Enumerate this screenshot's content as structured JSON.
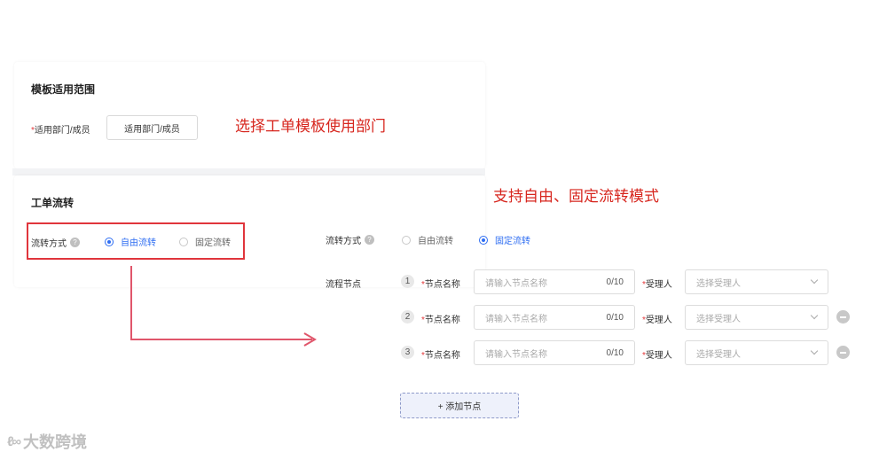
{
  "scope": {
    "title": "模板适用范围",
    "field_label": "适用部门/成员",
    "required_mark": "*",
    "button_label": "适用部门/成员"
  },
  "flow": {
    "title": "工单流转",
    "mode_label": "流转方式",
    "options": [
      "自由流转",
      "固定流转"
    ],
    "left_selected": "自由流转",
    "right_selected": "固定流转"
  },
  "annotations": {
    "scope_note": "选择工单模板使用部门",
    "flow_note": "支持自由、固定流转模式"
  },
  "nodes": {
    "section_label": "流程节点",
    "name_label": "节点名称",
    "assignee_label": "受理人",
    "required_mark": "*",
    "name_placeholder": "请输入节点名称",
    "assignee_placeholder": "选择受理人",
    "items": [
      {
        "num": "1",
        "count": "0/10",
        "removable": false
      },
      {
        "num": "2",
        "count": "0/10",
        "removable": true
      },
      {
        "num": "3",
        "count": "0/10",
        "removable": true
      }
    ],
    "add_label": "+ 添加节点"
  },
  "brand": {
    "logo_mark": "ℓ∞",
    "name": "大数跨境"
  },
  "colors": {
    "accent": "#2f6ef2",
    "annotation_red": "#d7261e",
    "arrow": "#e0566b"
  }
}
